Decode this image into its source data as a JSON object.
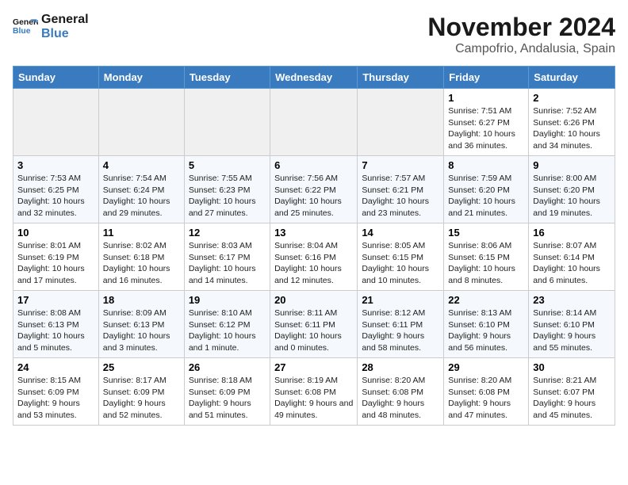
{
  "logo": {
    "line1": "General",
    "line2": "Blue"
  },
  "title": "November 2024",
  "location": "Campofrio, Andalusia, Spain",
  "days_of_week": [
    "Sunday",
    "Monday",
    "Tuesday",
    "Wednesday",
    "Thursday",
    "Friday",
    "Saturday"
  ],
  "weeks": [
    [
      {
        "day": "",
        "info": ""
      },
      {
        "day": "",
        "info": ""
      },
      {
        "day": "",
        "info": ""
      },
      {
        "day": "",
        "info": ""
      },
      {
        "day": "",
        "info": ""
      },
      {
        "day": "1",
        "info": "Sunrise: 7:51 AM\nSunset: 6:27 PM\nDaylight: 10 hours and 36 minutes."
      },
      {
        "day": "2",
        "info": "Sunrise: 7:52 AM\nSunset: 6:26 PM\nDaylight: 10 hours and 34 minutes."
      }
    ],
    [
      {
        "day": "3",
        "info": "Sunrise: 7:53 AM\nSunset: 6:25 PM\nDaylight: 10 hours and 32 minutes."
      },
      {
        "day": "4",
        "info": "Sunrise: 7:54 AM\nSunset: 6:24 PM\nDaylight: 10 hours and 29 minutes."
      },
      {
        "day": "5",
        "info": "Sunrise: 7:55 AM\nSunset: 6:23 PM\nDaylight: 10 hours and 27 minutes."
      },
      {
        "day": "6",
        "info": "Sunrise: 7:56 AM\nSunset: 6:22 PM\nDaylight: 10 hours and 25 minutes."
      },
      {
        "day": "7",
        "info": "Sunrise: 7:57 AM\nSunset: 6:21 PM\nDaylight: 10 hours and 23 minutes."
      },
      {
        "day": "8",
        "info": "Sunrise: 7:59 AM\nSunset: 6:20 PM\nDaylight: 10 hours and 21 minutes."
      },
      {
        "day": "9",
        "info": "Sunrise: 8:00 AM\nSunset: 6:20 PM\nDaylight: 10 hours and 19 minutes."
      }
    ],
    [
      {
        "day": "10",
        "info": "Sunrise: 8:01 AM\nSunset: 6:19 PM\nDaylight: 10 hours and 17 minutes."
      },
      {
        "day": "11",
        "info": "Sunrise: 8:02 AM\nSunset: 6:18 PM\nDaylight: 10 hours and 16 minutes."
      },
      {
        "day": "12",
        "info": "Sunrise: 8:03 AM\nSunset: 6:17 PM\nDaylight: 10 hours and 14 minutes."
      },
      {
        "day": "13",
        "info": "Sunrise: 8:04 AM\nSunset: 6:16 PM\nDaylight: 10 hours and 12 minutes."
      },
      {
        "day": "14",
        "info": "Sunrise: 8:05 AM\nSunset: 6:15 PM\nDaylight: 10 hours and 10 minutes."
      },
      {
        "day": "15",
        "info": "Sunrise: 8:06 AM\nSunset: 6:15 PM\nDaylight: 10 hours and 8 minutes."
      },
      {
        "day": "16",
        "info": "Sunrise: 8:07 AM\nSunset: 6:14 PM\nDaylight: 10 hours and 6 minutes."
      }
    ],
    [
      {
        "day": "17",
        "info": "Sunrise: 8:08 AM\nSunset: 6:13 PM\nDaylight: 10 hours and 5 minutes."
      },
      {
        "day": "18",
        "info": "Sunrise: 8:09 AM\nSunset: 6:13 PM\nDaylight: 10 hours and 3 minutes."
      },
      {
        "day": "19",
        "info": "Sunrise: 8:10 AM\nSunset: 6:12 PM\nDaylight: 10 hours and 1 minute."
      },
      {
        "day": "20",
        "info": "Sunrise: 8:11 AM\nSunset: 6:11 PM\nDaylight: 10 hours and 0 minutes."
      },
      {
        "day": "21",
        "info": "Sunrise: 8:12 AM\nSunset: 6:11 PM\nDaylight: 9 hours and 58 minutes."
      },
      {
        "day": "22",
        "info": "Sunrise: 8:13 AM\nSunset: 6:10 PM\nDaylight: 9 hours and 56 minutes."
      },
      {
        "day": "23",
        "info": "Sunrise: 8:14 AM\nSunset: 6:10 PM\nDaylight: 9 hours and 55 minutes."
      }
    ],
    [
      {
        "day": "24",
        "info": "Sunrise: 8:15 AM\nSunset: 6:09 PM\nDaylight: 9 hours and 53 minutes."
      },
      {
        "day": "25",
        "info": "Sunrise: 8:17 AM\nSunset: 6:09 PM\nDaylight: 9 hours and 52 minutes."
      },
      {
        "day": "26",
        "info": "Sunrise: 8:18 AM\nSunset: 6:09 PM\nDaylight: 9 hours and 51 minutes."
      },
      {
        "day": "27",
        "info": "Sunrise: 8:19 AM\nSunset: 6:08 PM\nDaylight: 9 hours and 49 minutes."
      },
      {
        "day": "28",
        "info": "Sunrise: 8:20 AM\nSunset: 6:08 PM\nDaylight: 9 hours and 48 minutes."
      },
      {
        "day": "29",
        "info": "Sunrise: 8:20 AM\nSunset: 6:08 PM\nDaylight: 9 hours and 47 minutes."
      },
      {
        "day": "30",
        "info": "Sunrise: 8:21 AM\nSunset: 6:07 PM\nDaylight: 9 hours and 45 minutes."
      }
    ]
  ]
}
